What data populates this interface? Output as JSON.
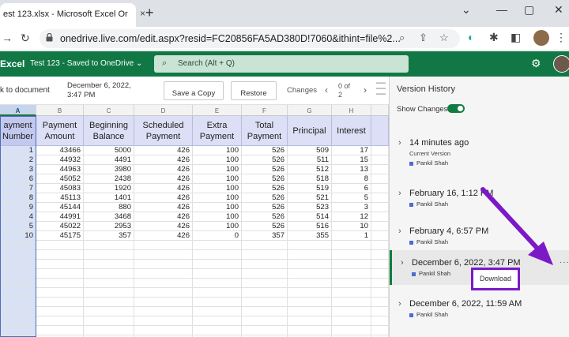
{
  "browser": {
    "tab_title": "est 123.xlsx - Microsoft Excel Or",
    "close": "×",
    "new_tab": "+",
    "minimize": "⌄",
    "win_min": "—",
    "win_max": "▢",
    "win_close": "✕",
    "url": "onedrive.live.com/edit.aspx?resid=FC20856FA5AD380D!7060&ithint=file%2..."
  },
  "excel": {
    "app_name": "Excel",
    "file_status": "Test 123 - Saved to OneDrive ⌄",
    "search_placeholder": "Search (Alt + Q)"
  },
  "toolbar": {
    "back_link": "k to document",
    "version_date": "December 6, 2022, 3:47 PM",
    "save_copy": "Save a Copy",
    "restore": "Restore",
    "changes": "Changes",
    "pager": "0 of 2"
  },
  "grid": {
    "col_letters": [
      "A",
      "B",
      "C",
      "D",
      "E",
      "F",
      "G",
      "H"
    ],
    "headers": [
      "ayment\nNumber",
      "Payment\nAmount",
      "Beginning\nBalance",
      "Scheduled\nPayment",
      "Extra\nPayment",
      "Total\nPayment",
      "Principal",
      "Interest"
    ],
    "rows": [
      [
        "1",
        "43466",
        "5000",
        "426",
        "100",
        "526",
        "509",
        "17"
      ],
      [
        "2",
        "44932",
        "4491",
        "426",
        "100",
        "526",
        "511",
        "15"
      ],
      [
        "3",
        "44963",
        "3980",
        "426",
        "100",
        "526",
        "512",
        "13"
      ],
      [
        "6",
        "45052",
        "2438",
        "426",
        "100",
        "526",
        "518",
        "8"
      ],
      [
        "7",
        "45083",
        "1920",
        "426",
        "100",
        "526",
        "519",
        "6"
      ],
      [
        "8",
        "45113",
        "1401",
        "426",
        "100",
        "526",
        "521",
        "5"
      ],
      [
        "9",
        "45144",
        "880",
        "426",
        "100",
        "526",
        "523",
        "3"
      ],
      [
        "4",
        "44991",
        "3468",
        "426",
        "100",
        "526",
        "514",
        "12"
      ],
      [
        "5",
        "45022",
        "2953",
        "426",
        "100",
        "526",
        "516",
        "10"
      ],
      [
        "10",
        "45175",
        "357",
        "426",
        "0",
        "357",
        "355",
        "1"
      ]
    ]
  },
  "version_history": {
    "title": "Version History",
    "show_changes": "Show Changes",
    "versions": [
      {
        "label": "14 minutes ago",
        "sub": "Current Version",
        "author": "Pankil Shah"
      },
      {
        "label": "February 16, 1:12 PM",
        "sub": "",
        "author": "Pankil Shah"
      },
      {
        "label": "February 4, 6:57 PM",
        "sub": "",
        "author": "Pankil Shah"
      },
      {
        "label": "December 6, 2022, 3:47 PM",
        "sub": "",
        "author": "Pankil Shah"
      },
      {
        "label": "December 6, 2022, 11:59 AM",
        "sub": "",
        "author": "Pankil Shah"
      }
    ],
    "more": "···",
    "download": "Download"
  },
  "colors": {
    "excel_green": "#117845",
    "annotation_purple": "#7c19c7"
  }
}
